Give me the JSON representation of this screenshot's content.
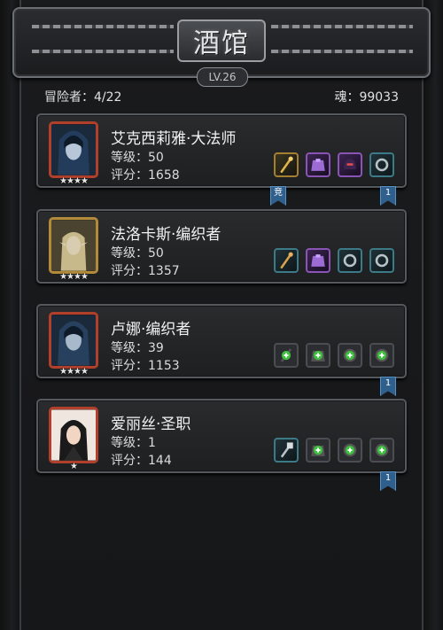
{
  "header": {
    "title": "酒馆",
    "level": "LV.26",
    "adventurers_label": "冒险者：4/22",
    "soul_label": "魂：99033"
  },
  "icons": {
    "staff": "staff-icon",
    "armor": "armor-icon",
    "helmet": "helmet-icon",
    "ring": "ring-icon",
    "plus": "plus-icon",
    "star": "star-icon"
  },
  "colors": {
    "ribbon": "#2f5f8c",
    "epic": "#8a54b6",
    "legend": "#a37f2f",
    "rare": "#3d7a88"
  },
  "heroes": [
    {
      "name": "艾克西莉雅·大法师",
      "level": "等级：50",
      "score": "评分：1658",
      "stars": "★★★★",
      "frame": "red",
      "left_ribbon": "竞",
      "right_ribbon": "1"
    },
    {
      "name": "法洛卡斯·编织者",
      "level": "等级：50",
      "score": "评分：1357",
      "stars": "★★★★",
      "frame": "gold"
    },
    {
      "name": "卢娜·编织者",
      "level": "等级：39",
      "score": "评分：1153",
      "stars": "★★★★",
      "frame": "red",
      "right_ribbon": "1"
    },
    {
      "name": "爱丽丝·圣职",
      "level": "等级：1",
      "score": "评分：144",
      "stars": "★",
      "frame": "red",
      "right_ribbon": "1"
    }
  ]
}
